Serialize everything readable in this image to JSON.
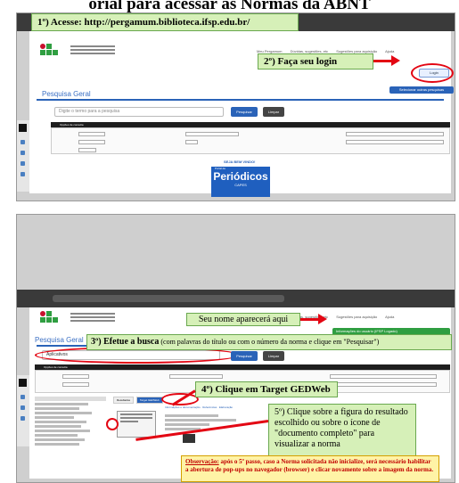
{
  "title": "orial para acessar as Normas da ABNT",
  "steps": {
    "s1": "1º) Acesse: http://pergamum.biblioteca.ifsp.edu.br/",
    "s2": "2º) Faça seu login",
    "s3_bold": "3º) Efetue a busca",
    "s3_rest": " (com palavras do título ou com o número da norma e clique em \"Pesquisar\")",
    "s4": "4º) Clique em Target GEDWeb",
    "s5": "5º) Clique sobre a figura do resultado escolhido ou sobre o ícone de \"documento completo\" para visualizar a norma",
    "name_note": "Seu nome aparecerá aqui",
    "obs_label": "Observação:",
    "obs_text": " após o 5º passo, caso a Norma solicitada não inicialize, será necessário habilitar a abertura de pop-ups no navegador (browser) e clicar novamente sobre a imagem da norma."
  },
  "screen1": {
    "url": "pergamum.biblioteca.ifsp.edu.br",
    "nav": [
      "Meu Pergamum",
      "Dúvidas, sugestões, etc",
      "Sugestões para aquisição",
      "Ajuda"
    ],
    "login": "Login",
    "search_title": "Pesquisa Geral",
    "search_placeholder": "Digite o termo para a pesquisa",
    "btn_search": "Pesquisar",
    "btn_clear": "Limpar",
    "options": "Opções de consulta",
    "welcome": "SEJA BEM VINDO!",
    "portal": "Portal de",
    "periodicos": "Periódicos",
    "capes": "CAPES",
    "blue_btn": "Selecionar outras pesquisas"
  },
  "screen2": {
    "search_title": "Pesquisa Geral",
    "search_value": "Aplicativos",
    "btn_search": "Pesquisar",
    "btn_clear": "Limpar",
    "user": "Informações do usuário (IFSP Logado)",
    "tabs": [
      "Resultados",
      "Target GEDWeb"
    ],
    "result_links": [
      "Informações e documentação",
      "Referências",
      "Elaboração"
    ]
  }
}
